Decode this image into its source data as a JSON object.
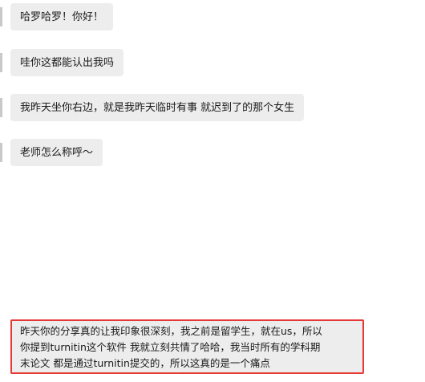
{
  "messages": [
    {
      "text": "哈罗哈罗！你好！"
    },
    {
      "text": "哇你这都能认出我吗"
    },
    {
      "text": "我昨天坐你右边，就是我昨天临时有事 就迟到了的那个女生"
    },
    {
      "text": "老师怎么称呼～"
    }
  ],
  "highlighted_message": {
    "lines": [
      "昨天你的分享真的让我印象很深刻，我之前是留学生，就在us，所以",
      "你提到turnitin这个软件 我就立刻共情了哈哈，我当时所有的学科期",
      "末论文 都是通过turnitin提交的，所以这真的是一个痛点"
    ],
    "highlight_color": "#e53935"
  },
  "colors": {
    "bubble_bg": "#ededed",
    "page_bg": "#ffffff"
  }
}
